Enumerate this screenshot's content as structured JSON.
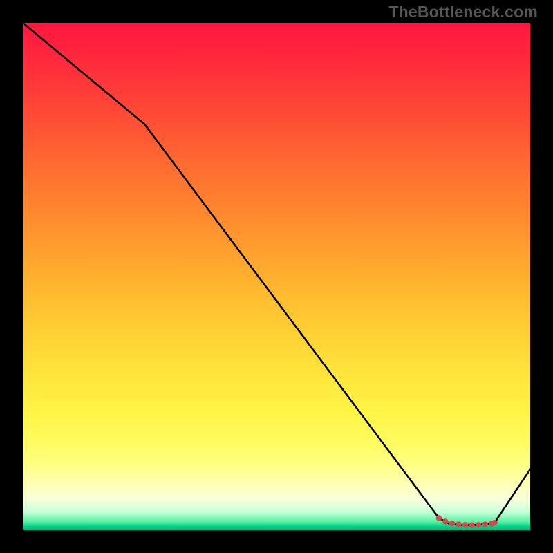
{
  "watermark": "TheBottleneck.com",
  "chart_data": {
    "type": "line",
    "title": "",
    "xlabel": "",
    "ylabel": "",
    "xlim": [
      0,
      100
    ],
    "ylim": [
      0,
      100
    ],
    "series": [
      {
        "name": "curve",
        "x": [
          0,
          24,
          82,
          84,
          85.5,
          87,
          88.5,
          90,
          91.5,
          93,
          100
        ],
        "values": [
          100,
          80,
          2.4,
          1.3,
          1.1,
          1.0,
          1.0,
          1.1,
          1.2,
          1.5,
          12
        ]
      }
    ],
    "markers": {
      "name": "flat-region",
      "color": "#d24a4a",
      "points_x": [
        82,
        83.3,
        84.6,
        85.9,
        87.2,
        88.5,
        89.8,
        91.1,
        92.4,
        93
      ],
      "points_y": [
        2.4,
        1.7,
        1.35,
        1.15,
        1.05,
        1.0,
        1.05,
        1.15,
        1.3,
        1.5
      ]
    },
    "background": {
      "type": "vertical-gradient",
      "stops": [
        {
          "pos": 0.0,
          "color": "#ff163f"
        },
        {
          "pos": 0.48,
          "color": "#ffa92e"
        },
        {
          "pos": 0.82,
          "color": "#fffb5c"
        },
        {
          "pos": 0.965,
          "color": "#c3ffd7"
        },
        {
          "pos": 1.0,
          "color": "#00b77f"
        }
      ]
    }
  }
}
